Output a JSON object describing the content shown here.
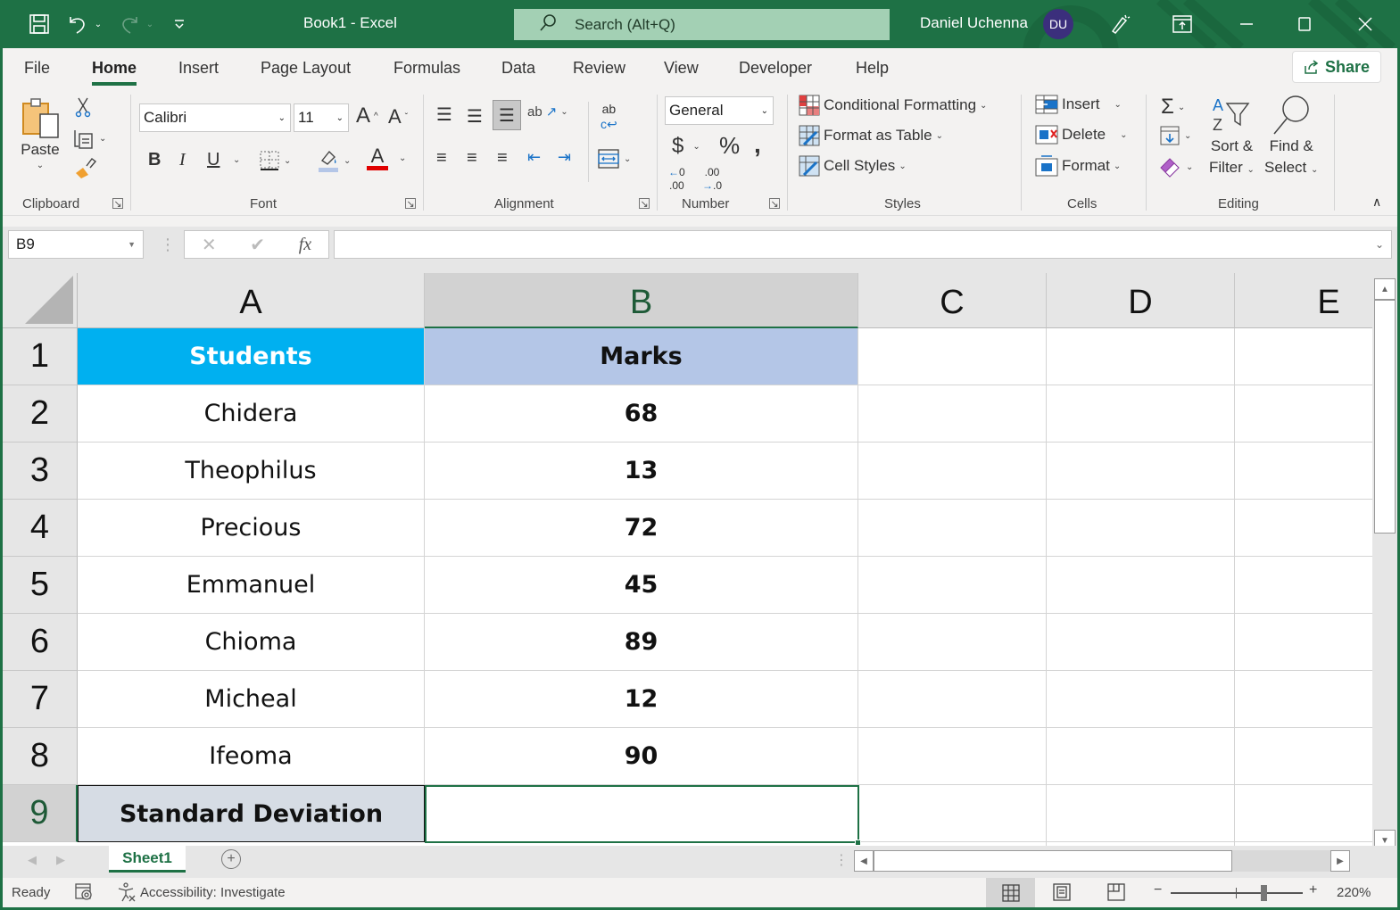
{
  "titlebar": {
    "title": "Book1  -  Excel",
    "search_placeholder": "Search (Alt+Q)",
    "user_name": "Daniel Uchenna",
    "user_initials": "DU"
  },
  "ribbon_tabs": [
    "File",
    "Home",
    "Insert",
    "Page Layout",
    "Formulas",
    "Data",
    "Review",
    "View",
    "Developer",
    "Help"
  ],
  "active_tab": "Home",
  "share_label": "Share",
  "clipboard": {
    "paste_label": "Paste",
    "group_label": "Clipboard"
  },
  "font": {
    "name": "Calibri",
    "size": "11",
    "group_label": "Font",
    "fill_color": "#b4c6e7",
    "font_color": "#e00000"
  },
  "alignment": {
    "group_label": "Alignment"
  },
  "number": {
    "format": "General",
    "group_label": "Number"
  },
  "styles": {
    "conditional_formatting": "Conditional Formatting",
    "format_as_table": "Format as Table",
    "cell_styles": "Cell Styles",
    "group_label": "Styles"
  },
  "cells": {
    "insert": "Insert",
    "delete": "Delete",
    "format": "Format",
    "group_label": "Cells"
  },
  "editing": {
    "sort_line1": "Sort &",
    "sort_line2": "Filter",
    "find_line1": "Find &",
    "find_line2": "Select",
    "group_label": "Editing"
  },
  "formula_bar": {
    "name_box": "B9",
    "formula": "",
    "fx": "fx"
  },
  "columns": [
    "A",
    "B",
    "C",
    "D",
    "E"
  ],
  "selected_column": "B",
  "rows": [
    "1",
    "2",
    "3",
    "4",
    "5",
    "6",
    "7",
    "8",
    "9"
  ],
  "selected_row": "9",
  "sheet": {
    "header": {
      "a": "Students",
      "b": "Marks",
      "a_fill": "#00b0f0",
      "b_fill": "#b4c6e7"
    },
    "data": [
      {
        "student": "Chidera",
        "mark": "68"
      },
      {
        "student": "Theophilus",
        "mark": "13"
      },
      {
        "student": "Precious",
        "mark": "72"
      },
      {
        "student": "Emmanuel",
        "mark": "45"
      },
      {
        "student": "Chioma",
        "mark": "89"
      },
      {
        "student": "Micheal",
        "mark": "12"
      },
      {
        "student": "Ifeoma",
        "mark": "90"
      }
    ],
    "footer": {
      "a": "Standard Deviation",
      "b": "",
      "a_fill": "#d6dce4"
    }
  },
  "sheet_tabs": [
    "Sheet1"
  ],
  "active_sheet": "Sheet1",
  "status": {
    "ready": "Ready",
    "accessibility": "Accessibility: Investigate",
    "zoom": "220%",
    "zoom_percent": 220
  },
  "colors": {
    "brand": "#1e7145"
  }
}
